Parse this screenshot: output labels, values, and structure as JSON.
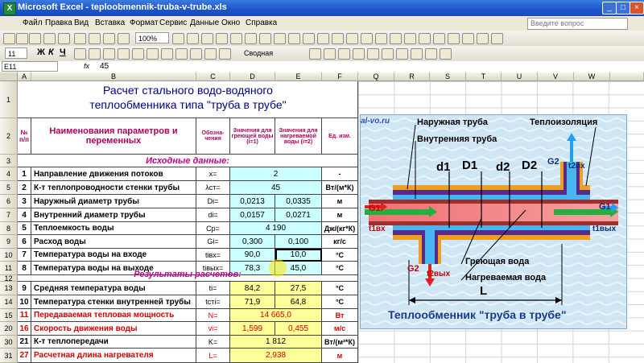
{
  "window": {
    "title": "Microsoft Excel - teploobmennik-truba-v-trube.xls",
    "help_placeholder": "Введите вопрос"
  },
  "menu": [
    "Файл",
    "Правка",
    "Вид",
    "Вставка",
    "Формат",
    "Сервис",
    "Данные",
    "Окно",
    "Справка"
  ],
  "toolbar": {
    "zoom": "100%",
    "font_size": "11",
    "bold": "Ж",
    "italic": "К",
    "underline": "Ч",
    "pivot": "Сводная таблица"
  },
  "formula_bar": {
    "cell_ref": "E11",
    "fx": "fx",
    "value": "45"
  },
  "columns": [
    "A",
    "B",
    "C",
    "D",
    "E",
    "F",
    "Q",
    "R",
    "S",
    "T",
    "U",
    "V",
    "W"
  ],
  "rows": [
    "1",
    "2",
    "3",
    "4",
    "5",
    "6",
    "7",
    "8",
    "9",
    "10",
    "11",
    "12",
    "13",
    "14",
    "15",
    "16",
    "20",
    "30",
    "31"
  ],
  "sheet": {
    "title_line1": "Расчет стального водо-водяного",
    "title_line2": "теплообменника типа \"труба в трубе\"",
    "h_num": "№ п/п",
    "h_name": "Наименования параметров и переменных",
    "h_sym": "Обозна-чения",
    "h_v1": "Значения для греющей воды (i=1)",
    "h_v2": "Значения для нагреваемой воды (i=2)",
    "h_unit": "Ед. изм.",
    "section_input": "Исходные данные:",
    "section_results": "Результаты расчетов:",
    "watermark": "al-vo.ru",
    "input_rows": [
      {
        "n": "1",
        "name": "Направление движения потоков",
        "sym": "x=",
        "v1": "2",
        "v2": "",
        "unit": "-",
        "merged": true,
        "row": "4"
      },
      {
        "n": "2",
        "name": "К-т теплопроводности стенки трубы",
        "sym": "λст=",
        "v1": "45",
        "v2": "",
        "unit": "Вт/(м*К)",
        "merged": true,
        "row": "5"
      },
      {
        "n": "3",
        "name": "Наружный диаметр трубы",
        "sym": "Di=",
        "v1": "0,0213",
        "v2": "0,0335",
        "unit": "м",
        "merged": false,
        "row": "6"
      },
      {
        "n": "4",
        "name": "Внутренний диаметр трубы",
        "sym": "di=",
        "v1": "0,0157",
        "v2": "0,0271",
        "unit": "м",
        "merged": false,
        "row": "7"
      },
      {
        "n": "5",
        "name": "Теплоемкость воды",
        "sym": "Cp=",
        "v1": "4 190",
        "v2": "",
        "unit": "Дж/(кг*К)",
        "merged": true,
        "row": "8"
      },
      {
        "n": "6",
        "name": "Расход воды",
        "sym": "Gi=",
        "v1": "0,300",
        "v2": "0,100",
        "unit": "кг/с",
        "merged": false,
        "row": "9"
      },
      {
        "n": "7",
        "name": "Температура воды на входе",
        "sym": "tiвх=",
        "v1": "90,0",
        "v2": "10,0",
        "unit": "°С",
        "merged": false,
        "row": "10"
      },
      {
        "n": "8",
        "name": "Температура воды на выходе",
        "sym": "tiвых=",
        "v1": "78,3",
        "v2": "45,0",
        "unit": "°С",
        "merged": false,
        "row": "11"
      }
    ],
    "result_rows": [
      {
        "n": "9",
        "name": "Средняя температура воды",
        "sym": "ti=",
        "v1": "84,2",
        "v2": "27,5",
        "unit": "°С",
        "merged": false,
        "style": "black",
        "row": "13"
      },
      {
        "n": "10",
        "name": "Температура стенки внутренней трубы",
        "sym": "tсті=",
        "v1": "71,9",
        "v2": "64,8",
        "unit": "°С",
        "merged": false,
        "style": "black",
        "row": "14"
      },
      {
        "n": "11",
        "name": "Передаваемая тепловая мощность",
        "sym": "N=",
        "v1": "14 665,0",
        "v2": "",
        "unit": "Вт",
        "merged": true,
        "style": "red",
        "row": "15"
      },
      {
        "n": "16",
        "name": "Скорость движения воды",
        "sym": "vi=",
        "v1": "1,599",
        "v2": "0,455",
        "unit": "м/с",
        "merged": false,
        "style": "red",
        "row": "20"
      },
      {
        "n": "21",
        "name": "К-т теплопередачи",
        "sym": "K=",
        "v1": "1 812",
        "v2": "",
        "unit": "Вт/(м²*К)",
        "merged": true,
        "style": "black",
        "row": "30"
      },
      {
        "n": "27",
        "name": "Расчетная длина нагревателя",
        "sym": "L=",
        "v1": "2,938",
        "v2": "",
        "unit": "м",
        "merged": true,
        "style": "red",
        "row": "31"
      }
    ]
  },
  "diagram": {
    "outer_pipe": "Наружная труба",
    "insulation": "Теплоизоляция",
    "inner_pipe": "Внутренняя труба",
    "d1": "d1",
    "D1": "D1",
    "d2": "d2",
    "D2": "D2",
    "G2": "G2",
    "t2in": "t2вх",
    "G1": "G1",
    "t1in": "t1вх",
    "G1out": "G1",
    "t1out": "t1вых",
    "G2out": "G2",
    "t2out": "t2вых",
    "heating_water": "Греющая вода",
    "heated_water": "Нагреваемая вода",
    "L": "L",
    "caption": "Теплообменник \"труба в трубе\"",
    "colors": {
      "inner": "#9e2f2f",
      "outer": "#5a2a8a",
      "insulation": "#f0a020",
      "flow_hot": "#e02020",
      "flow_cold": "#20a0f0",
      "bg": "#cfe6f5"
    }
  }
}
